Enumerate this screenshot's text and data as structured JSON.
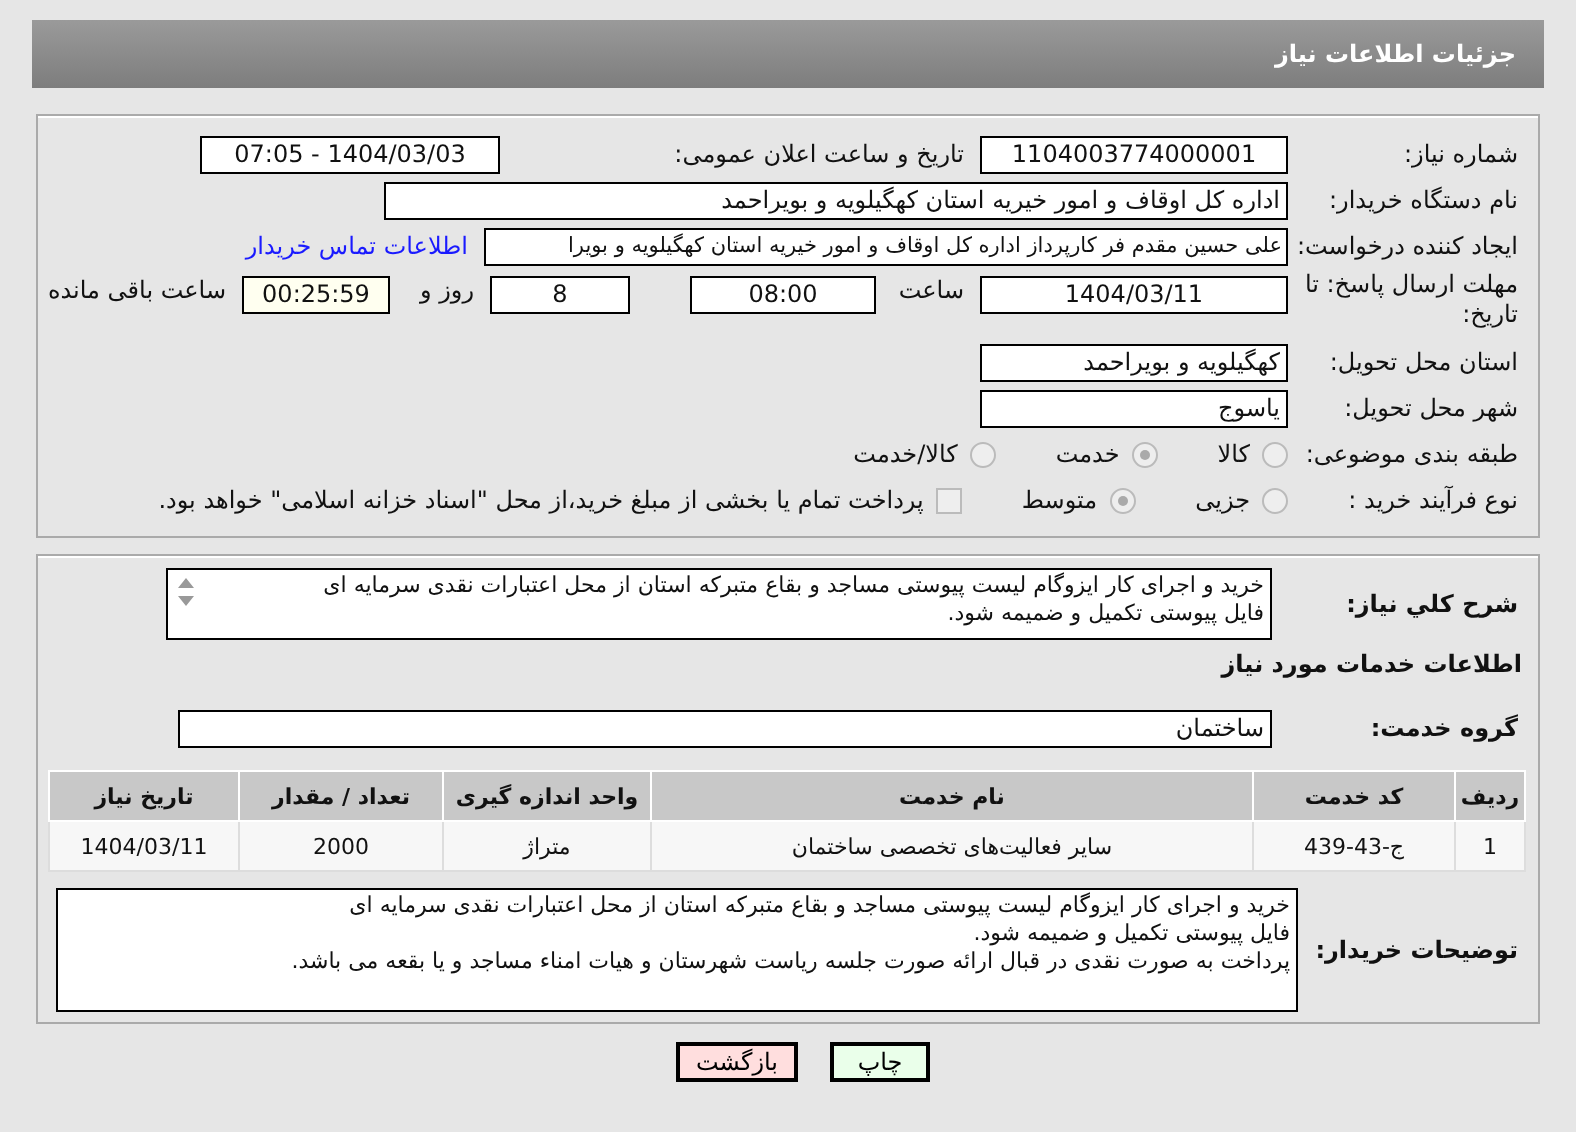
{
  "header": {
    "title": "جزئیات اطلاعات نیاز"
  },
  "details": {
    "need_number": {
      "label": "شماره نیاز:",
      "value": "1104003774000001"
    },
    "announce": {
      "label": "تاریخ و ساعت اعلان عمومی:",
      "value": "1404/03/03 - 07:05"
    },
    "buyer": {
      "label": "نام دستگاه خریدار:",
      "value": "اداره کل اوقاف و امور خیریه استان کهگیلویه و بویراحمد"
    },
    "requester": {
      "label": "ایجاد کننده درخواست:",
      "value": "علی حسین مقدم فر کارپرداز اداره کل اوقاف و امور خیریه استان کهگیلویه و بویرا",
      "link": "اطلاعات تماس خریدار"
    },
    "deadline": {
      "label": "مهلت ارسال پاسخ: تا تاریخ:",
      "date": "1404/03/11",
      "time_label": "ساعت",
      "time": "08:00",
      "days": "8",
      "days_label": "روز و",
      "remaining": "00:25:59",
      "remaining_label": "ساعت باقی مانده"
    },
    "province": {
      "label": "استان محل تحویل:",
      "value": "کهگیلویه و بویراحمد"
    },
    "city": {
      "label": "شهر محل تحویل:",
      "value": "یاسوج"
    },
    "category": {
      "label": "طبقه بندی موضوعی:",
      "options": [
        {
          "label": "کالا",
          "selected": false
        },
        {
          "label": "خدمت",
          "selected": true
        },
        {
          "label": "کالا/خدمت",
          "selected": false
        }
      ]
    },
    "process": {
      "label": "نوع فرآیند خرید :",
      "options": [
        {
          "label": "جزیی",
          "selected": false
        },
        {
          "label": "متوسط",
          "selected": true
        }
      ],
      "payment": {
        "checked": false,
        "text": "پرداخت تمام یا بخشی از مبلغ خرید،از محل \"اسناد خزانه اسلامی\" خواهد بود."
      }
    }
  },
  "summary": {
    "label": "شرح کلي نياز:",
    "text": "خرید و اجرای کار ایزوگام لیست پیوستی مساجد و بقاع متبرکه استان از محل اعتبارات نقدی سرمایه ای\nفایل پیوستی تکمیل و ضمیمه شود."
  },
  "services": {
    "heading": "اطلاعات خدمات مورد نیاز",
    "group_label": "گروه خدمت:",
    "group": "ساختمان",
    "columns": [
      "ردیف",
      "کد خدمت",
      "نام خدمت",
      "واحد اندازه گیری",
      "تعداد / مقدار",
      "تاریخ نیاز"
    ],
    "rows": [
      [
        "1",
        "ج-43-439",
        "سایر فعالیت‌های تخصصی ساختمان",
        "متراژ",
        "2000",
        "1404/03/11"
      ]
    ]
  },
  "buyer_notes": {
    "label": "توضیحات خریدار:",
    "text": "خرید و اجرای کار ایزوگام لیست پیوستی مساجد و بقاع متبرکه استان از محل اعتبارات نقدی سرمایه ای\nفایل پیوستی تکمیل و ضمیمه شود.\nپرداخت به صورت نقدی در قبال ارائه صورت جلسه ریاست شهرستان و هیات امناء مساجد و یا بقعه می باشد."
  },
  "buttons": [
    {
      "label": "چاپ",
      "kind": "print"
    },
    {
      "label": "بازگشت",
      "kind": "back"
    }
  ]
}
